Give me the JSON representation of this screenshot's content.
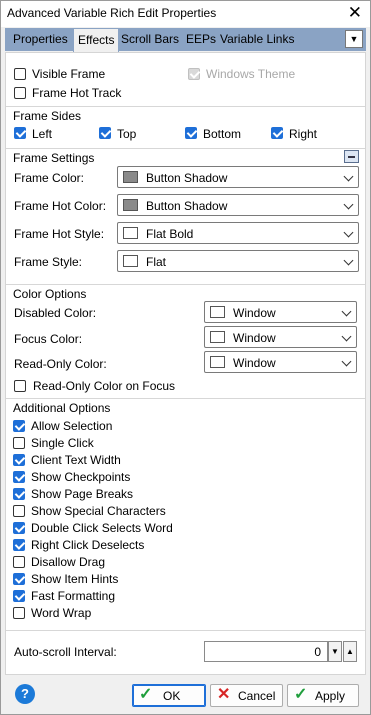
{
  "window": {
    "title": "Advanced Variable Rich Edit Properties"
  },
  "tabs": [
    "Properties",
    "Effects",
    "Scroll Bars",
    "EEPs",
    "Variable Links"
  ],
  "active_tab": "Effects",
  "frame": {
    "visible_frame": {
      "label": "Visible Frame",
      "checked": false
    },
    "frame_hot_track": {
      "label": "Frame Hot Track",
      "checked": false
    },
    "windows_theme": {
      "label": "Windows Theme",
      "checked": true,
      "disabled": true
    }
  },
  "frame_sides": {
    "title": "Frame Sides",
    "items": [
      {
        "label": "Left",
        "checked": true
      },
      {
        "label": "Top",
        "checked": true
      },
      {
        "label": "Bottom",
        "checked": true
      },
      {
        "label": "Right",
        "checked": true
      }
    ]
  },
  "frame_settings": {
    "title": "Frame Settings",
    "rows": [
      {
        "label": "Frame Color:",
        "value": "Button Shadow",
        "swatch": "#8a8a8a"
      },
      {
        "label": "Frame Hot Color:",
        "value": "Button Shadow",
        "swatch": "#8a8a8a"
      },
      {
        "label": "Frame Hot Style:",
        "value": "Flat Bold",
        "swatch": "#ffffff"
      },
      {
        "label": "Frame Style:",
        "value": "Flat",
        "swatch": "#ffffff"
      }
    ]
  },
  "color_options": {
    "title": "Color Options",
    "rows": [
      {
        "label": "Disabled Color:",
        "value": "Window",
        "swatch": "#ffffff"
      },
      {
        "label": "Focus Color:",
        "value": "Window",
        "swatch": "#ffffff"
      },
      {
        "label": "Read-Only Color:",
        "value": "Window",
        "swatch": "#ffffff"
      }
    ],
    "read_only_on_focus": {
      "label": "Read-Only Color on Focus",
      "checked": false
    }
  },
  "additional_options": {
    "title": "Additional Options",
    "items": [
      {
        "label": "Allow Selection",
        "checked": true
      },
      {
        "label": "Single Click",
        "checked": false
      },
      {
        "label": "Client Text Width",
        "checked": true
      },
      {
        "label": "Show Checkpoints",
        "checked": true
      },
      {
        "label": "Show Page Breaks",
        "checked": true
      },
      {
        "label": "Show Special Characters",
        "checked": false
      },
      {
        "label": "Double Click Selects Word",
        "checked": true
      },
      {
        "label": "Right Click Deselects",
        "checked": true
      },
      {
        "label": "Disallow Drag",
        "checked": false
      },
      {
        "label": "Show Item Hints",
        "checked": true
      },
      {
        "label": "Fast Formatting",
        "checked": true
      },
      {
        "label": "Word Wrap",
        "checked": false
      }
    ]
  },
  "auto_scroll": {
    "label": "Auto-scroll Interval:",
    "value": "0"
  },
  "buttons": {
    "ok": "OK",
    "cancel": "Cancel",
    "apply": "Apply",
    "help": "?"
  },
  "colors": {
    "accent": "#1e6fd8",
    "tab_strip": "#8aa3c4"
  }
}
